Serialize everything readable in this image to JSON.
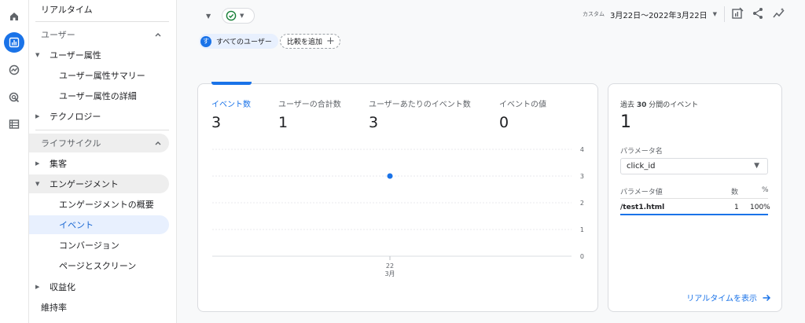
{
  "sidebar": {
    "realtime": "リアルタイム",
    "user_section": "ユーザー",
    "user_attributes": "ユーザー属性",
    "user_attr_summary": "ユーザー属性サマリー",
    "user_attr_detail": "ユーザー属性の詳細",
    "technology": "テクノロジー",
    "lifecycle_section": "ライフサイクル",
    "acquisition": "集客",
    "engagement": "エンゲージメント",
    "engagement_overview": "エンゲージメントの概要",
    "events": "イベント",
    "conversions": "コンバージョン",
    "pages_screens": "ページとスクリーン",
    "monetization": "収益化",
    "retention": "維持率"
  },
  "filters": {
    "user_chip_initial": "す",
    "user_chip_label": "すべてのユーザー",
    "compare_label": "比較を追加"
  },
  "date": {
    "custom_label": "カスタム",
    "range": "3月22日～2022年3月22日"
  },
  "metrics": [
    {
      "label": "イベント数",
      "value": "3"
    },
    {
      "label": "ユーザーの合計数",
      "value": "1"
    },
    {
      "label": "ユーザーあたりのイベント数",
      "value": "3"
    },
    {
      "label": "イベントの値",
      "value": "0"
    }
  ],
  "chart_data": {
    "type": "scatter",
    "x": [
      "22 3月"
    ],
    "y": [
      3
    ],
    "x_tick": "22",
    "x_tick_month": "3月",
    "y_ticks": [
      "4",
      "3",
      "2",
      "1",
      "0"
    ],
    "ylim": [
      0,
      4
    ]
  },
  "side": {
    "title_prefix": "過去",
    "title_num": "30",
    "title_suffix": "分間のイベント",
    "value": "1",
    "param_name_label": "パラメータ名",
    "param_selected": "click_id",
    "col_value": "パラメータ値",
    "col_count": "数",
    "col_pct": "%",
    "row_value": "/test1.html",
    "row_count": "1",
    "row_pct": "100%",
    "realtime_link": "リアルタイムを表示"
  },
  "colors": {
    "accent": "#1a73e8",
    "status_ok": "#188038"
  }
}
